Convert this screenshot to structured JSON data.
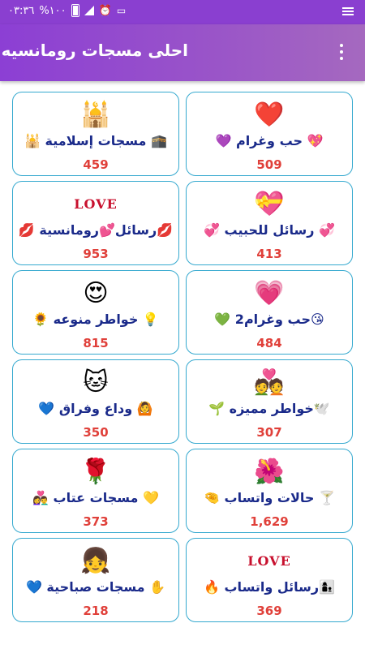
{
  "status_bar": {
    "time": "٠٣:٣٦",
    "battery": "%١٠٠"
  },
  "app_bar": {
    "title": "احلى مسجات رومانسيه"
  },
  "cards": [
    {
      "label": "💖 حب وغرام 💜",
      "count": "509",
      "thumb_icon": "❤️"
    },
    {
      "label": "🕋 مسجات إسلامية 🕌",
      "count": "459",
      "thumb_icon": "🕌"
    },
    {
      "label": "💞 رسائل للحبيب 💞",
      "count": "413",
      "thumb_icon": "💝"
    },
    {
      "label": "💋رسائل💕رومانسية 💋",
      "count": "953",
      "thumb_text": "LOVE"
    },
    {
      "label": "😘حب وغرام2 💚",
      "count": "484",
      "thumb_icon": "💗"
    },
    {
      "label": "💡 خواطر منوعه 🌻",
      "count": "815",
      "thumb_icon": "😍"
    },
    {
      "label": "🕊️خواطر مميزه 🌱",
      "count": "307",
      "thumb_icon": "💑"
    },
    {
      "label": "🙆 وداع وفراق 💙",
      "count": "350",
      "thumb_icon": "🐱"
    },
    {
      "label": "🍸 حالات واتساب 🤏",
      "count": "1,629",
      "thumb_icon": "🌺"
    },
    {
      "label": "💛 مسجات عتاب 👩‍❤️‍👨",
      "count": "373",
      "thumb_icon": "🌹"
    },
    {
      "label": "👩‍👦رسائل واتساب 🔥",
      "count": "369",
      "thumb_text": "LOVE"
    },
    {
      "label": "✋ مسجات صباحية 💙",
      "count": "218",
      "thumb_icon": "👧"
    }
  ]
}
